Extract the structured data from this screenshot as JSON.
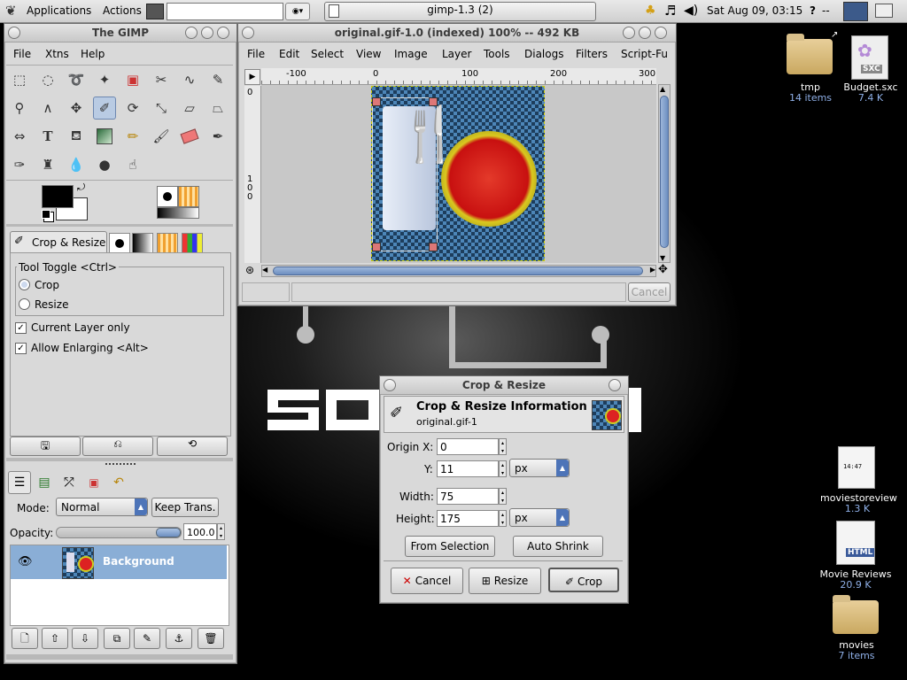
{
  "panel": {
    "applications": "Applications",
    "actions": "Actions",
    "task_label": "gimp-1.3 (2)",
    "clock": "Sat Aug 09, 03:15",
    "help": "?",
    "dash": "--",
    "search_value": ""
  },
  "toolbox": {
    "title": "The GIMP",
    "menu": [
      "File",
      "Xtns",
      "Help"
    ],
    "tool_options_tab": "Crop & Resize",
    "tool_toggle": "Tool Toggle  <Ctrl>",
    "crop_label": "Crop",
    "resize_label": "Resize",
    "current_layer_only": "Current Layer only",
    "allow_enlarging": "Allow Enlarging  <Alt>"
  },
  "layers": {
    "mode_label": "Mode:",
    "mode_value": "Normal",
    "keep_trans": "Keep Trans.",
    "opacity_label": "Opacity:",
    "opacity_value": "100.0",
    "opacity_fraction": 1.0,
    "layer_name": "Background"
  },
  "image_window": {
    "title": "original.gif-1.0 (indexed) 100% -- 492 KB",
    "menu": [
      "File",
      "Edit",
      "Select",
      "View",
      "Image",
      "Layer",
      "Tools",
      "Dialogs",
      "Filters",
      "Script-Fu"
    ],
    "ruler_labels": [
      "-100",
      "0",
      "100",
      "200",
      "300"
    ],
    "vruler_labels": [
      "0",
      "1",
      "0",
      "0"
    ],
    "cancel": "Cancel"
  },
  "crop_dialog": {
    "title": "Crop & Resize",
    "header": "Crop & Resize Information",
    "subheader": "original.gif-1",
    "origin_x_label": "Origin X:",
    "origin_x_value": "0",
    "y_label": "Y:",
    "y_value": "11",
    "unit1": "px",
    "width_label": "Width:",
    "width_value": "75",
    "height_label": "Height:",
    "height_value": "175",
    "unit2": "px",
    "from_selection": "From Selection",
    "auto_shrink": "Auto Shrink",
    "cancel": "Cancel",
    "resize": "Resize",
    "crop": "Crop"
  },
  "desktop": {
    "icons": [
      {
        "name": "tmp",
        "sub": "14 items"
      },
      {
        "name": "Budget.sxc",
        "sub": "7.4 K"
      },
      {
        "name": "moviestoreview",
        "sub": "1.3 K"
      },
      {
        "name": "Movie Reviews",
        "sub": "20.9 K"
      },
      {
        "name": "movies",
        "sub": "7 items"
      }
    ],
    "file_thumb_text": "14:47",
    "html_badge": "HTML",
    "sxc_badge": "SXC"
  }
}
